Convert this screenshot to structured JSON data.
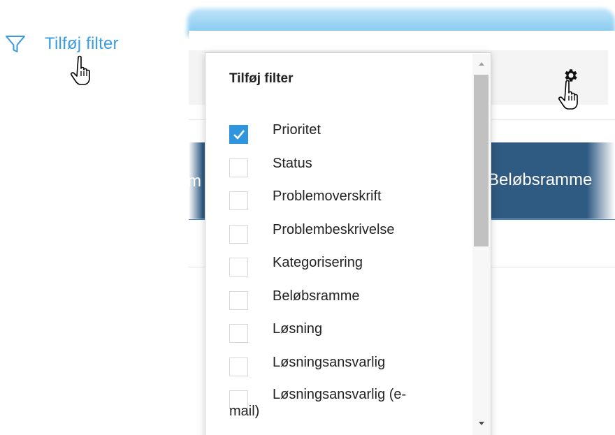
{
  "trigger": {
    "label": "Tilføj filter"
  },
  "background": {
    "column_left_fragment": "m",
    "column_right": "Beløbsramme"
  },
  "dropdown": {
    "title": "Tilføj filter",
    "options": [
      {
        "label": "Prioritet",
        "checked": true
      },
      {
        "label": "Status",
        "checked": false
      },
      {
        "label": "Problemoverskrift",
        "checked": false
      },
      {
        "label": "Problembeskrivelse",
        "checked": false
      },
      {
        "label": "Kategorisering",
        "checked": false
      },
      {
        "label": "Beløbsramme",
        "checked": false
      },
      {
        "label": "Løsning",
        "checked": false
      },
      {
        "label": "Løsningsansvarlig",
        "checked": false
      },
      {
        "label": "Løsningsansvarlig (e-mail)",
        "checked": false
      }
    ]
  },
  "colors": {
    "accent": "#2e95de",
    "link": "#3a9be0",
    "header": "#2f5a82"
  },
  "icons": [
    "filter-icon",
    "gear-icon",
    "hand-pointer-icon",
    "checkmark-icon"
  ]
}
